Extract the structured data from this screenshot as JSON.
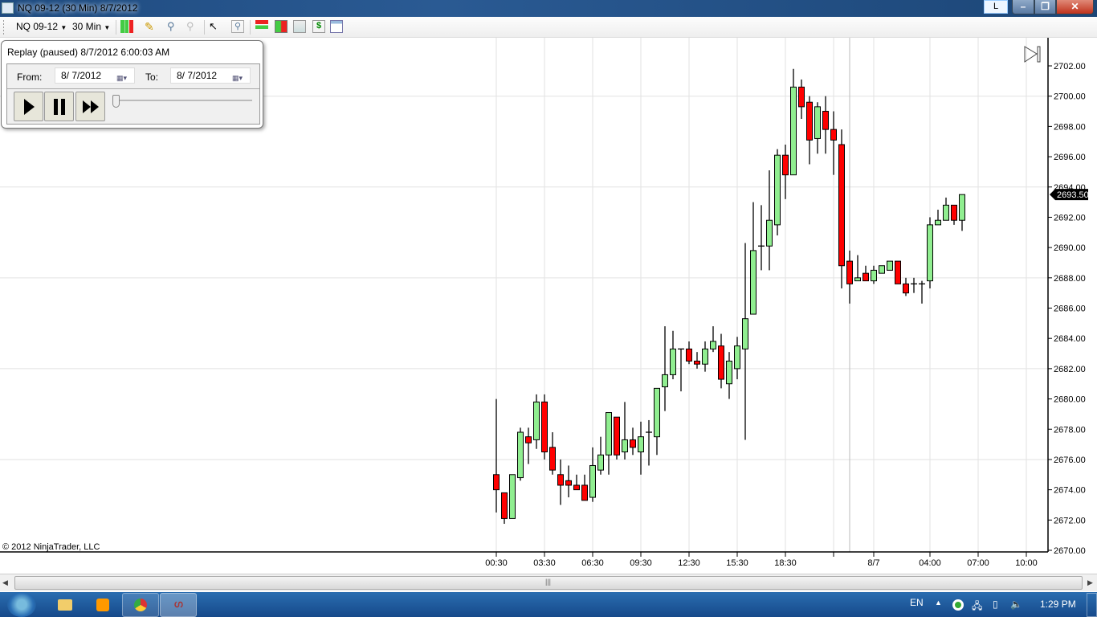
{
  "window": {
    "title": "NQ 09-12 (30 Min)  8/7/2012",
    "lang_indicator": "L",
    "minimize": "–",
    "restore": "❐",
    "close": "✕"
  },
  "toolbar": {
    "instrument": "NQ 09-12",
    "interval": "30 Min",
    "icons": [
      "chart-style-icon",
      "drawing-pencil-icon",
      "zoom-in-icon",
      "zoom-out-icon",
      "cursor-icon",
      "magnifier-icon",
      "order-icon",
      "chart-trader-icon",
      "indicators-icon",
      "strategy-icon",
      "properties-icon"
    ]
  },
  "replay": {
    "status": "Replay (paused) 8/7/2012 6:00:03 AM",
    "from_label": "From:",
    "from_value": "8/  7/2012",
    "to_label": "To:",
    "to_value": "8/  7/2012",
    "slider_fraction": 0.0
  },
  "copyright": "© 2012 NinjaTrader, LLC",
  "taskbar": {
    "language": "EN",
    "clock": "1:29 PM"
  },
  "colors": {
    "up": "#90ee90",
    "down": "#ff0000",
    "grid": "#e2e2e2"
  },
  "chart_data": {
    "type": "candlestick",
    "instrument": "NQ 09-12",
    "interval": "30 Min",
    "ylim": [
      2670,
      2702
    ],
    "y_ticks": [
      "2702.00",
      "2700.00",
      "2698.00",
      "2696.00",
      "2694.00",
      "2692.00",
      "2690.00",
      "2688.00",
      "2686.00",
      "2684.00",
      "2682.00",
      "2680.00",
      "2678.00",
      "2676.00",
      "2674.00",
      "2672.00",
      "2670.00"
    ],
    "last_price": "2693.50",
    "x_labels": [
      {
        "bar": 0,
        "label": "00:30"
      },
      {
        "bar": 6,
        "label": "03:30"
      },
      {
        "bar": 12,
        "label": "06:30"
      },
      {
        "bar": 18,
        "label": "09:30"
      },
      {
        "bar": 24,
        "label": "12:30"
      },
      {
        "bar": 30,
        "label": "15:30"
      },
      {
        "bar": 36,
        "label": "18:30"
      },
      {
        "bar": 42,
        "label": ""
      },
      {
        "bar": 47,
        "label": "8/7"
      },
      {
        "bar": 54,
        "label": "04:00"
      },
      {
        "bar": 60,
        "label": "07:00"
      },
      {
        "bar": 66,
        "label": "10:00"
      }
    ],
    "session_break_bar": 44,
    "ohlc": [
      [
        2675.0,
        2680.0,
        2672.5,
        2674.0
      ],
      [
        2673.8,
        2673.8,
        2671.75,
        2672.1
      ],
      [
        2672.1,
        2675.0,
        2672.1,
        2675.0
      ],
      [
        2674.8,
        2678.1,
        2674.6,
        2677.8
      ],
      [
        2677.5,
        2678.1,
        2675.7,
        2677.1
      ],
      [
        2677.3,
        2680.3,
        2676.7,
        2679.8
      ],
      [
        2679.8,
        2680.3,
        2676.0,
        2676.5
      ],
      [
        2676.8,
        2677.8,
        2675.0,
        2675.3
      ],
      [
        2675.0,
        2676.0,
        2673.0,
        2674.3
      ],
      [
        2674.6,
        2675.6,
        2673.5,
        2674.3
      ],
      [
        2674.3,
        2675.0,
        2674.0,
        2674.0
      ],
      [
        2674.3,
        2675.0,
        2673.3,
        2673.3
      ],
      [
        2673.5,
        2676.8,
        2673.2,
        2675.6
      ],
      [
        2675.3,
        2677.5,
        2675.0,
        2676.3
      ],
      [
        2676.3,
        2679.1,
        2675.0,
        2679.1
      ],
      [
        2678.8,
        2678.8,
        2676.0,
        2676.3
      ],
      [
        2676.5,
        2679.8,
        2676.0,
        2677.3
      ],
      [
        2677.3,
        2678.1,
        2676.3,
        2676.8
      ],
      [
        2676.5,
        2678.5,
        2675.0,
        2677.5
      ],
      [
        2677.8,
        2678.6,
        2675.6,
        2677.8
      ],
      [
        2677.5,
        2680.7,
        2676.3,
        2680.7
      ],
      [
        2680.8,
        2684.8,
        2679.2,
        2681.6
      ],
      [
        2681.6,
        2684.5,
        2681.3,
        2683.3
      ],
      [
        2683.3,
        2683.3,
        2680.5,
        2683.3
      ],
      [
        2683.3,
        2683.8,
        2682.3,
        2682.5
      ],
      [
        2682.5,
        2683.1,
        2682.0,
        2682.3
      ],
      [
        2682.3,
        2683.8,
        2681.8,
        2683.3
      ],
      [
        2683.3,
        2684.8,
        2683.1,
        2683.8
      ],
      [
        2683.5,
        2684.3,
        2680.7,
        2681.3
      ],
      [
        2681.0,
        2683.1,
        2680.0,
        2682.5
      ],
      [
        2682.0,
        2684.1,
        2681.3,
        2683.5
      ],
      [
        2683.3,
        2690.3,
        2677.3,
        2685.3
      ],
      [
        2685.6,
        2693.0,
        2685.6,
        2689.8
      ],
      [
        2690.1,
        2692.8,
        2688.5,
        2690.1
      ],
      [
        2690.1,
        2695.1,
        2688.5,
        2691.8
      ],
      [
        2691.5,
        2696.5,
        2690.8,
        2696.1
      ],
      [
        2696.1,
        2696.8,
        2693.2,
        2694.8
      ],
      [
        2694.8,
        2701.8,
        2694.8,
        2700.6
      ],
      [
        2700.6,
        2701.1,
        2698.5,
        2699.3
      ],
      [
        2699.6,
        2700.0,
        2695.5,
        2697.1
      ],
      [
        2697.2,
        2699.6,
        2696.2,
        2699.3
      ],
      [
        2699.0,
        2700.0,
        2696.2,
        2697.8
      ],
      [
        2697.8,
        2699.0,
        2694.8,
        2697.1
      ],
      [
        2696.8,
        2697.8,
        2687.3,
        2688.8
      ],
      [
        2689.1,
        2689.8,
        2686.3,
        2687.6
      ],
      [
        2687.8,
        2689.5,
        2687.8,
        2688.0
      ],
      [
        2688.3,
        2688.8,
        2687.8,
        2687.8
      ],
      [
        2687.8,
        2688.8,
        2687.6,
        2688.5
      ],
      [
        2688.3,
        2688.8,
        2688.3,
        2688.8
      ],
      [
        2688.5,
        2689.1,
        2688.5,
        2689.1
      ],
      [
        2689.1,
        2689.1,
        2687.6,
        2687.6
      ],
      [
        2687.6,
        2688.0,
        2686.8,
        2687.0
      ],
      [
        2687.6,
        2688.0,
        2687.0,
        2687.6
      ],
      [
        2687.6,
        2687.8,
        2686.3,
        2687.6
      ],
      [
        2687.8,
        2692.0,
        2687.3,
        2691.5
      ],
      [
        2691.5,
        2692.5,
        2691.5,
        2691.8
      ],
      [
        2691.8,
        2693.3,
        2691.8,
        2692.8
      ],
      [
        2692.8,
        2692.8,
        2691.5,
        2691.8
      ],
      [
        2691.8,
        2693.5,
        2691.1,
        2693.5
      ]
    ]
  }
}
